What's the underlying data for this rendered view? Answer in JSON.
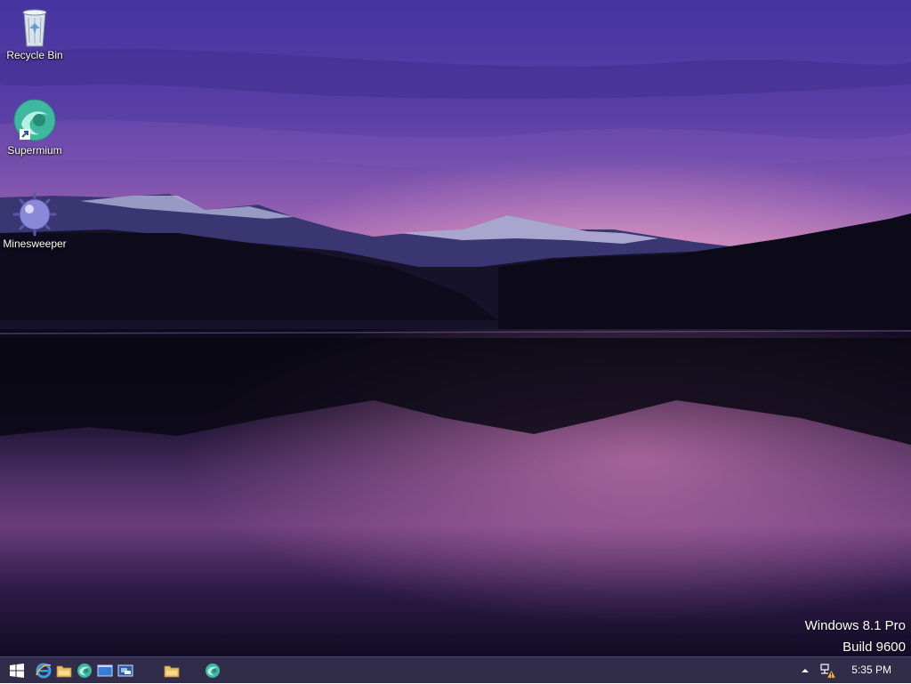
{
  "desktop": {
    "icons": [
      {
        "label": "Recycle Bin",
        "icon": "recycle-bin-icon"
      },
      {
        "label": "Supermium",
        "icon": "supermium-browser-icon"
      },
      {
        "label": "Minesweeper",
        "icon": "minesweeper-mine-icon"
      }
    ]
  },
  "watermark": {
    "line1": "Windows 8.1 Pro",
    "line2": "Build 9600"
  },
  "taskbar": {
    "start_icon": "windows-logo-icon",
    "pinned": [
      "internet-explorer-icon",
      "file-explorer-icon",
      "supermium-icon",
      "desktop-window-icon",
      "remote-desktop-icon"
    ],
    "running": [
      "file-explorer-icon",
      "supermium-icon"
    ],
    "tray": {
      "icons": [
        "show-hidden-icons-chevron",
        "network-warning-icon"
      ],
      "clock": "5:35 PM"
    }
  },
  "colors": {
    "taskbar_bg": "#1e1a3a",
    "sky_top": "#4a3b9e",
    "sky_glow": "#d98fc0",
    "lake": "#1a1030"
  }
}
